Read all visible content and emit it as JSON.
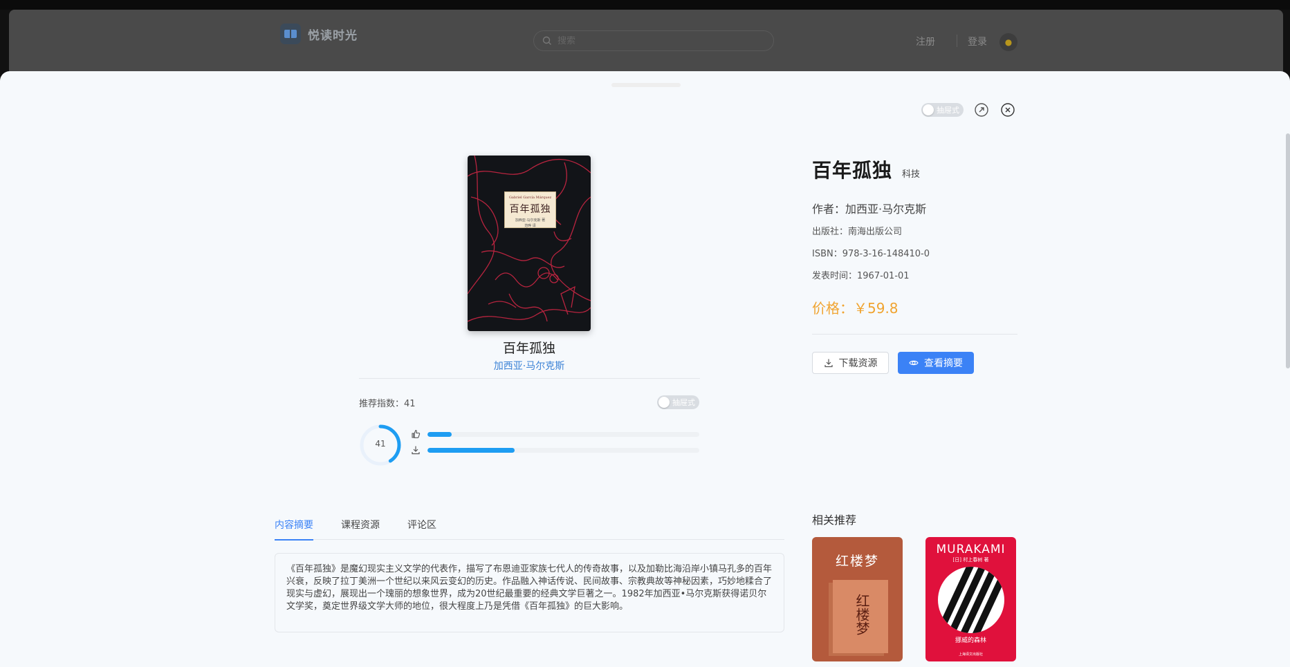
{
  "app": {
    "name": "悦读时光",
    "search_placeholder": "搜索",
    "register": "注册",
    "login": "登录"
  },
  "modal": {
    "toggle_label": "抽屉式",
    "book": {
      "title": "百年孤独",
      "category": "科技",
      "author": "加西亚·马尔克斯",
      "author_line": "作者：加西亚·马尔克斯",
      "publisher_line": "出版社：南海出版公司",
      "isbn_line": "ISBN：978-3-16-148410-0",
      "date_line": "发表时间：1967-01-01",
      "price_line": "价格：￥59.8",
      "cover": {
        "author_en": "Gabriel García Márquez",
        "title_cn": "百年孤独",
        "author_cn": "加西亚·马尔克斯 著",
        "translator": "范晔 译"
      }
    },
    "stats": {
      "recommend_label": "推荐指数：41",
      "score": "41",
      "score_fraction": 0.41,
      "likes_fraction": 0.09,
      "downloads_fraction": 0.32,
      "toggle_label": "抽屉式"
    },
    "actions": {
      "download": "下载资源",
      "view_summary": "查看摘要"
    },
    "tabs": [
      "内容摘要",
      "课程资源",
      "评论区"
    ],
    "summary": "《百年孤独》是魔幻现实主义文学的代表作，描写了布恩迪亚家族七代人的传奇故事，以及加勒比海沿岸小镇马孔多的百年兴衰，反映了拉丁美洲一个世纪以来风云变幻的历史。作品融入神话传说、民间故事、宗教典故等神秘因素，巧妙地糅合了现实与虚幻，展现出一个瑰丽的想象世界，成为20世纪最重要的经典文学巨著之一。1982年加西亚•马尔克斯获得诺贝尔文学奖，奠定世界级文学大师的地位，很大程度上乃是凭借《百年孤独》的巨大影响。",
    "related": {
      "title": "相关推荐",
      "books": [
        {
          "title": "红楼梦",
          "spine": "红楼梦"
        },
        {
          "title": "MURAKAMI",
          "sub": "[日] 村上春树 著",
          "name": "挪威的森林",
          "publisher": "上海译文出版社"
        }
      ]
    }
  }
}
